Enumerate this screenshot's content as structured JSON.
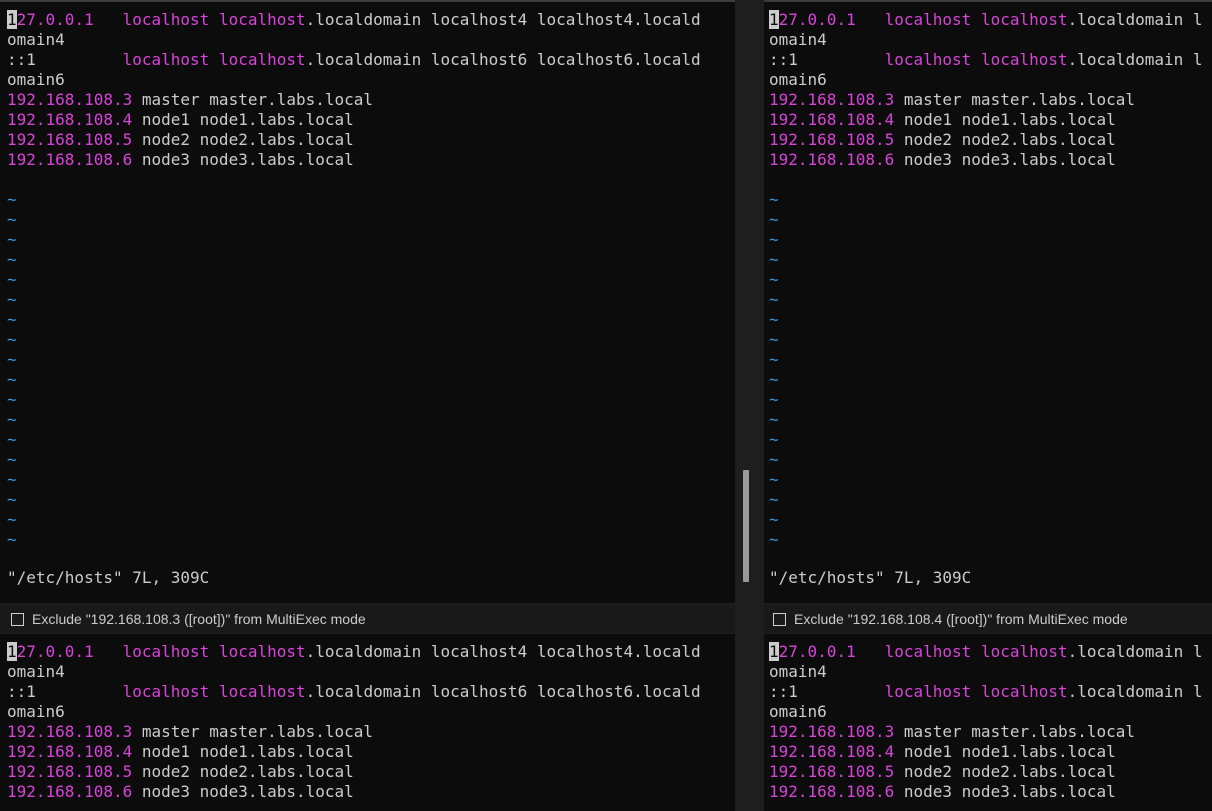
{
  "panes": [
    {
      "id": "master",
      "lines": [
        {
          "parts": [
            {
              "t": "1",
              "c": "cursor"
            },
            {
              "t": "27.0.0.1",
              "c": "ip"
            },
            {
              "t": "   ",
              "c": "plain"
            },
            {
              "t": "localhost localhost",
              "c": "kw"
            },
            {
              "t": ".localdomain localhost4 localhost4.locald",
              "c": "plain"
            }
          ]
        },
        {
          "parts": [
            {
              "t": "omain4",
              "c": "plain"
            }
          ]
        },
        {
          "parts": [
            {
              "t": "::1",
              "c": "plain"
            },
            {
              "t": "         ",
              "c": "plain"
            },
            {
              "t": "localhost localhost",
              "c": "kw"
            },
            {
              "t": ".localdomain localhost6 localhost6.locald",
              "c": "plain"
            }
          ]
        },
        {
          "parts": [
            {
              "t": "omain6",
              "c": "plain"
            }
          ]
        },
        {
          "parts": [
            {
              "t": "192.168.108.3",
              "c": "ip"
            },
            {
              "t": " master master.labs.local",
              "c": "plain"
            }
          ]
        },
        {
          "parts": [
            {
              "t": "192.168.108.4",
              "c": "ip"
            },
            {
              "t": " node1 node1.labs.local",
              "c": "plain"
            }
          ]
        },
        {
          "parts": [
            {
              "t": "192.168.108.5",
              "c": "ip"
            },
            {
              "t": " node2 node2.labs.local",
              "c": "plain"
            }
          ]
        },
        {
          "parts": [
            {
              "t": "192.168.108.6",
              "c": "ip"
            },
            {
              "t": " node3 node3.labs.local",
              "c": "plain"
            }
          ]
        },
        {
          "parts": []
        },
        {
          "parts": [
            {
              "t": "~",
              "c": "tilde"
            }
          ]
        },
        {
          "parts": [
            {
              "t": "~",
              "c": "tilde"
            }
          ]
        },
        {
          "parts": [
            {
              "t": "~",
              "c": "tilde"
            }
          ]
        },
        {
          "parts": [
            {
              "t": "~",
              "c": "tilde"
            }
          ]
        },
        {
          "parts": [
            {
              "t": "~",
              "c": "tilde"
            }
          ]
        },
        {
          "parts": [
            {
              "t": "~",
              "c": "tilde"
            }
          ]
        },
        {
          "parts": [
            {
              "t": "~",
              "c": "tilde"
            }
          ]
        },
        {
          "parts": [
            {
              "t": "~",
              "c": "tilde"
            }
          ]
        },
        {
          "parts": [
            {
              "t": "~",
              "c": "tilde"
            }
          ]
        },
        {
          "parts": [
            {
              "t": "~",
              "c": "tilde"
            }
          ]
        },
        {
          "parts": [
            {
              "t": "~",
              "c": "tilde"
            }
          ]
        },
        {
          "parts": [
            {
              "t": "~",
              "c": "tilde"
            }
          ]
        },
        {
          "parts": [
            {
              "t": "~",
              "c": "tilde"
            }
          ]
        },
        {
          "parts": [
            {
              "t": "~",
              "c": "tilde"
            }
          ]
        },
        {
          "parts": [
            {
              "t": "~",
              "c": "tilde"
            }
          ]
        },
        {
          "parts": [
            {
              "t": "~",
              "c": "tilde"
            }
          ]
        },
        {
          "parts": [
            {
              "t": "~",
              "c": "tilde"
            }
          ]
        },
        {
          "parts": [
            {
              "t": "~",
              "c": "tilde"
            }
          ]
        }
      ],
      "status": "\"/etc/hosts\" 7L, 309C",
      "multiexec_label": "Exclude \"192.168.108.3 ([root])\" from MultiExec mode"
    },
    {
      "id": "node1",
      "lines": [
        {
          "parts": [
            {
              "t": "1",
              "c": "cursor"
            },
            {
              "t": "27.0.0.1",
              "c": "ip"
            },
            {
              "t": "   ",
              "c": "plain"
            },
            {
              "t": "localhost localhost",
              "c": "kw"
            },
            {
              "t": ".localdomain l",
              "c": "plain"
            }
          ]
        },
        {
          "parts": [
            {
              "t": "omain4",
              "c": "plain"
            }
          ]
        },
        {
          "parts": [
            {
              "t": "::1",
              "c": "plain"
            },
            {
              "t": "         ",
              "c": "plain"
            },
            {
              "t": "localhost localhost",
              "c": "kw"
            },
            {
              "t": ".localdomain l",
              "c": "plain"
            }
          ]
        },
        {
          "parts": [
            {
              "t": "omain6",
              "c": "plain"
            }
          ]
        },
        {
          "parts": [
            {
              "t": "192.168.108.3",
              "c": "ip"
            },
            {
              "t": " master master.labs.local",
              "c": "plain"
            }
          ]
        },
        {
          "parts": [
            {
              "t": "192.168.108.4",
              "c": "ip"
            },
            {
              "t": " node1 node1.labs.local",
              "c": "plain"
            }
          ]
        },
        {
          "parts": [
            {
              "t": "192.168.108.5",
              "c": "ip"
            },
            {
              "t": " node2 node2.labs.local",
              "c": "plain"
            }
          ]
        },
        {
          "parts": [
            {
              "t": "192.168.108.6",
              "c": "ip"
            },
            {
              "t": " node3 node3.labs.local",
              "c": "plain"
            }
          ]
        },
        {
          "parts": []
        },
        {
          "parts": [
            {
              "t": "~",
              "c": "tilde"
            }
          ]
        },
        {
          "parts": [
            {
              "t": "~",
              "c": "tilde"
            }
          ]
        },
        {
          "parts": [
            {
              "t": "~",
              "c": "tilde"
            }
          ]
        },
        {
          "parts": [
            {
              "t": "~",
              "c": "tilde"
            }
          ]
        },
        {
          "parts": [
            {
              "t": "~",
              "c": "tilde"
            }
          ]
        },
        {
          "parts": [
            {
              "t": "~",
              "c": "tilde"
            }
          ]
        },
        {
          "parts": [
            {
              "t": "~",
              "c": "tilde"
            }
          ]
        },
        {
          "parts": [
            {
              "t": "~",
              "c": "tilde"
            }
          ]
        },
        {
          "parts": [
            {
              "t": "~",
              "c": "tilde"
            }
          ]
        },
        {
          "parts": [
            {
              "t": "~",
              "c": "tilde"
            }
          ]
        },
        {
          "parts": [
            {
              "t": "~",
              "c": "tilde"
            }
          ]
        },
        {
          "parts": [
            {
              "t": "~",
              "c": "tilde"
            }
          ]
        },
        {
          "parts": [
            {
              "t": "~",
              "c": "tilde"
            }
          ]
        },
        {
          "parts": [
            {
              "t": "~",
              "c": "tilde"
            }
          ]
        },
        {
          "parts": [
            {
              "t": "~",
              "c": "tilde"
            }
          ]
        },
        {
          "parts": [
            {
              "t": "~",
              "c": "tilde"
            }
          ]
        },
        {
          "parts": [
            {
              "t": "~",
              "c": "tilde"
            }
          ]
        },
        {
          "parts": [
            {
              "t": "~",
              "c": "tilde"
            }
          ]
        }
      ],
      "status": "\"/etc/hosts\" 7L, 309C",
      "multiexec_label": "Exclude \"192.168.108.4 ([root])\" from MultiExec mode"
    },
    {
      "id": "node2",
      "lines": [
        {
          "parts": [
            {
              "t": "1",
              "c": "cursor"
            },
            {
              "t": "27.0.0.1",
              "c": "ip"
            },
            {
              "t": "   ",
              "c": "plain"
            },
            {
              "t": "localhost localhost",
              "c": "kw"
            },
            {
              "t": ".localdomain localhost4 localhost4.locald",
              "c": "plain"
            }
          ]
        },
        {
          "parts": [
            {
              "t": "omain4",
              "c": "plain"
            }
          ]
        },
        {
          "parts": [
            {
              "t": "::1",
              "c": "plain"
            },
            {
              "t": "         ",
              "c": "plain"
            },
            {
              "t": "localhost localhost",
              "c": "kw"
            },
            {
              "t": ".localdomain localhost6 localhost6.locald",
              "c": "plain"
            }
          ]
        },
        {
          "parts": [
            {
              "t": "omain6",
              "c": "plain"
            }
          ]
        },
        {
          "parts": [
            {
              "t": "192.168.108.3",
              "c": "ip"
            },
            {
              "t": " master master.labs.local",
              "c": "plain"
            }
          ]
        },
        {
          "parts": [
            {
              "t": "192.168.108.4",
              "c": "ip"
            },
            {
              "t": " node1 node1.labs.local",
              "c": "plain"
            }
          ]
        },
        {
          "parts": [
            {
              "t": "192.168.108.5",
              "c": "ip"
            },
            {
              "t": " node2 node2.labs.local",
              "c": "plain"
            }
          ]
        },
        {
          "parts": [
            {
              "t": "192.168.108.6",
              "c": "ip"
            },
            {
              "t": " node3 node3.labs.local",
              "c": "plain"
            }
          ]
        }
      ]
    },
    {
      "id": "node3",
      "lines": [
        {
          "parts": [
            {
              "t": "1",
              "c": "cursor"
            },
            {
              "t": "27.0.0.1",
              "c": "ip"
            },
            {
              "t": "   ",
              "c": "plain"
            },
            {
              "t": "localhost localhost",
              "c": "kw"
            },
            {
              "t": ".localdomain l",
              "c": "plain"
            }
          ]
        },
        {
          "parts": [
            {
              "t": "omain4",
              "c": "plain"
            }
          ]
        },
        {
          "parts": [
            {
              "t": "::1",
              "c": "plain"
            },
            {
              "t": "         ",
              "c": "plain"
            },
            {
              "t": "localhost localhost",
              "c": "kw"
            },
            {
              "t": ".localdomain l",
              "c": "plain"
            }
          ]
        },
        {
          "parts": [
            {
              "t": "omain6",
              "c": "plain"
            }
          ]
        },
        {
          "parts": [
            {
              "t": "192.168.108.3",
              "c": "ip"
            },
            {
              "t": " master master.labs.local",
              "c": "plain"
            }
          ]
        },
        {
          "parts": [
            {
              "t": "192.168.108.4",
              "c": "ip"
            },
            {
              "t": " node1 node1.labs.local",
              "c": "plain"
            }
          ]
        },
        {
          "parts": [
            {
              "t": "192.168.108.5",
              "c": "ip"
            },
            {
              "t": " node2 node2.labs.local",
              "c": "plain"
            }
          ]
        },
        {
          "parts": [
            {
              "t": "192.168.108.6",
              "c": "ip"
            },
            {
              "t": " node3 node3.labs.local",
              "c": "plain"
            }
          ]
        }
      ]
    }
  ],
  "colors": {
    "terminal_bg": "#0c0c0c",
    "ip_keyword": "#d843d8",
    "text": "#cccccc",
    "tilde": "#3a96dd",
    "bar_bg": "#191919"
  }
}
